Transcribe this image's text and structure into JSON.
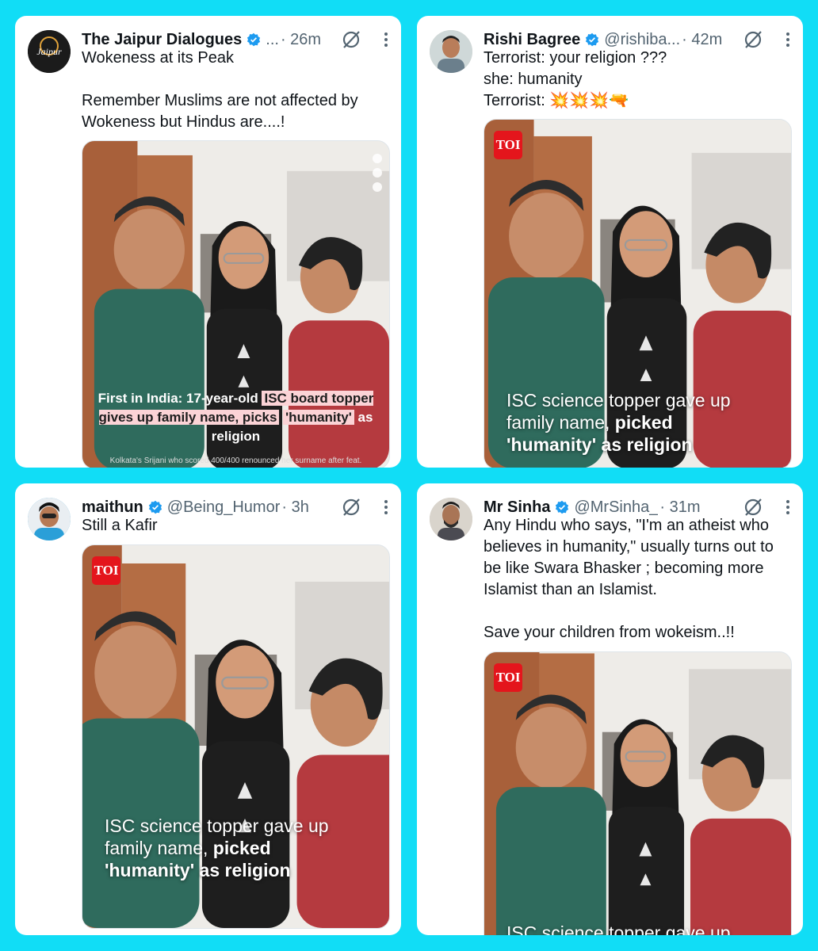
{
  "colors": {
    "background": "#11ddf6",
    "verified": "#1d9bf0",
    "toi_red": "#e4151c"
  },
  "tweets": [
    {
      "name": "The Jaipur Dialogues",
      "handle": "...",
      "time": "· 26m",
      "text": "Wokeness at its Peak\n\nRemember Muslims are not affected by Wokeness but Hindus are....!",
      "media": {
        "caption_pre": "First in India: 17-year-old",
        "caption_hl1": "ISC board topper gives up family name, picks",
        "caption_hl2": "'humanity'",
        "caption_post": "as religion",
        "subcaption": "Kolkata's Srijani who scored 400/400 renounced her surname after feat.",
        "avatar_text": "Jaipur"
      }
    },
    {
      "name": "Rishi Bagree",
      "handle": "@rishiba...",
      "time": "· 42m",
      "text": "Terrorist: your religion ???\nshe: humanity\nTerrorist: 💥💥💥🔫",
      "media": {
        "logo": "TOI",
        "line1": "ISC science topper gave up",
        "line2_pre": "family name, ",
        "line2_bold": "picked",
        "line3_bold": "'humanity'",
        "line3_post": " as religion"
      }
    },
    {
      "name": "maithun",
      "handle": "@Being_Humor",
      "time": "· 3h",
      "text": "Still a Kafir",
      "media": {
        "logo": "TOI",
        "line1": "ISC science topper gave up",
        "line2_pre": "family name, ",
        "line2_bold": "picked",
        "line3_bold": "'humanity'",
        "line3_post": " as religion"
      }
    },
    {
      "name": "Mr Sinha",
      "handle": "@MrSinha_",
      "time": "· 31m",
      "text": "Any Hindu who says, \"I'm an atheist who believes in humanity,\" usually turns out to be like Swara Bhasker ; becoming more Islamist than an Islamist.\n\nSave your children from wokeism..!!",
      "media": {
        "logo": "TOI",
        "line1": "ISC science topper gave up"
      }
    }
  ]
}
